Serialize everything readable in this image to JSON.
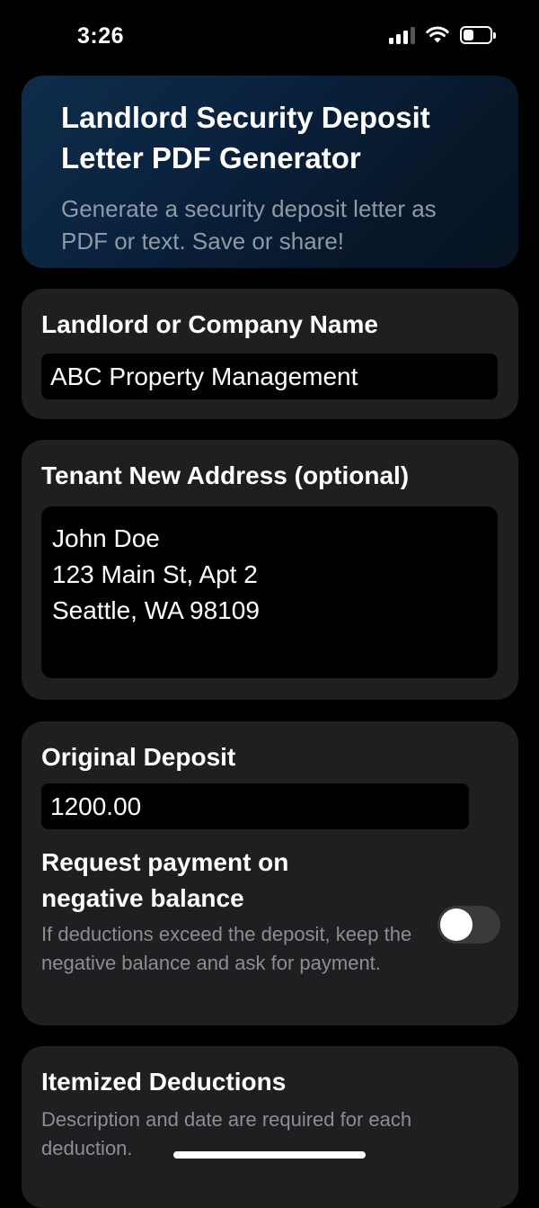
{
  "status_bar": {
    "time": "3:26",
    "icons": [
      "signal-icon",
      "wifi-icon",
      "battery-icon"
    ]
  },
  "header": {
    "title": "Landlord Security Deposit Letter PDF Generator",
    "subtitle": "Generate a security deposit letter as PDF or text. Save or share!"
  },
  "landlord": {
    "label": "Landlord or Company Name",
    "value": "ABC Property Management"
  },
  "tenant_address": {
    "label": "Tenant New Address (optional)",
    "lines": [
      "John Doe",
      "123 Main St, Apt 2",
      "Seattle, WA 98109"
    ]
  },
  "deposit": {
    "label": "Original Deposit",
    "value": "1200.00"
  },
  "negative_balance": {
    "title_line1": "Request payment on",
    "title_line2": "negative balance",
    "description": "If deductions exceed the deposit, keep the negative balance and ask for payment.",
    "enabled": false
  },
  "deductions": {
    "title": "Itemized Deductions",
    "description": "Description and date are required for each deduction."
  },
  "colors": {
    "background": "#000000",
    "card": "#1f1f21",
    "header_gradient_start": "#0e2d4a",
    "muted_text": "#8d8d92",
    "toggle_off": "#3a3a3c"
  }
}
